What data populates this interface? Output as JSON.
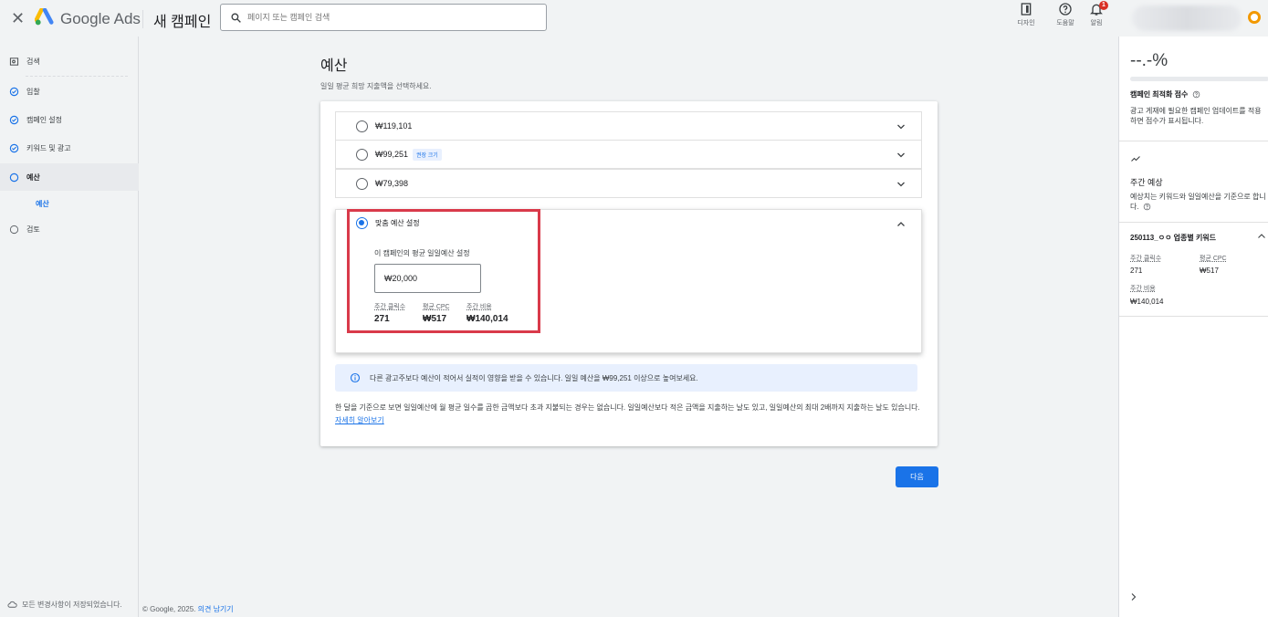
{
  "header": {
    "brand": "Google Ads",
    "campaign_title": "새 캠페인",
    "search_placeholder": "페이지 또는 캠페인 검색",
    "icons": [
      {
        "name": "design-icon",
        "label": "디자인"
      },
      {
        "name": "help-icon",
        "label": "도움말"
      },
      {
        "name": "notifications-icon",
        "label": "알림",
        "badge": "1"
      }
    ]
  },
  "sidebar": {
    "items": [
      {
        "label": "검색",
        "icon": "search-box-icon"
      },
      {
        "label": "입찰",
        "icon": "check-circle-icon"
      },
      {
        "label": "캠페인 설정",
        "icon": "check-circle-icon"
      },
      {
        "label": "키워드 및 광고",
        "icon": "check-circle-icon"
      },
      {
        "label": "예산",
        "icon": "empty-circle-icon",
        "active": true
      },
      {
        "label": "검토",
        "icon": "empty-circle-icon"
      }
    ],
    "sub_item": "예산",
    "saved_note": "모든 변경사항이 저장되었습니다."
  },
  "footer": {
    "copyright": "© Google, 2025.",
    "feedback_link": "의견 남기기"
  },
  "main": {
    "title": "예산",
    "subtitle": "일일 평균 희망 지출액을 선택하세요.",
    "options": [
      {
        "value": "₩119,101"
      },
      {
        "value": "₩99,251",
        "chip": "권장 크기"
      },
      {
        "value": "₩79,398"
      }
    ],
    "custom": {
      "label": "맞춤 예산 설정",
      "field_label": "이 캠페인의 평균 일일예산 설정",
      "input_value": "₩20,000",
      "stats": [
        {
          "key": "주간 클릭수",
          "value": "271"
        },
        {
          "key": "평균 CPC",
          "value": "₩517"
        },
        {
          "key": "주간 비용",
          "value": "₩140,014"
        }
      ]
    },
    "info": "다른 광고주보다 예산이 적어서 실적이 영향을 받을 수 있습니다. 일일 예산을 ₩99,251 이상으로 높여보세요.",
    "note": "한 달을 기준으로 보면 일일예산에 월 평균 일수를 곱한 금액보다 초과 지불되는 경우는 없습니다. 일일예산보다 적은 금액을 지출하는 날도 있고, 일일예산의 최대 2배까지 지출하는 날도 있습니다.",
    "note_link": "자세히 알아보기",
    "next_button": "다음"
  },
  "right_panel": {
    "score": "--.-%",
    "score_title": "캠페인 최적화 점수",
    "score_desc": "광고 게재에 필요한 캠페인 업데이트를 적용하면 점수가 표시됩니다.",
    "forecast_title": "주간 예상",
    "forecast_desc": "예상치는 키워드와 일일예산을 기준으로 합니다.",
    "group_title": "250113_ㅇㅇ 업종별 키워드",
    "clicks_key": "주간 클릭수",
    "clicks_value": "271",
    "cpc_key": "평균 CPC",
    "cpc_value": "₩517",
    "cost_key": "주간 비용",
    "cost_value": "₩140,014"
  },
  "colors": {
    "accent": "#1a73e8",
    "highlight": "#d93a4a",
    "badge": "#d93025"
  }
}
